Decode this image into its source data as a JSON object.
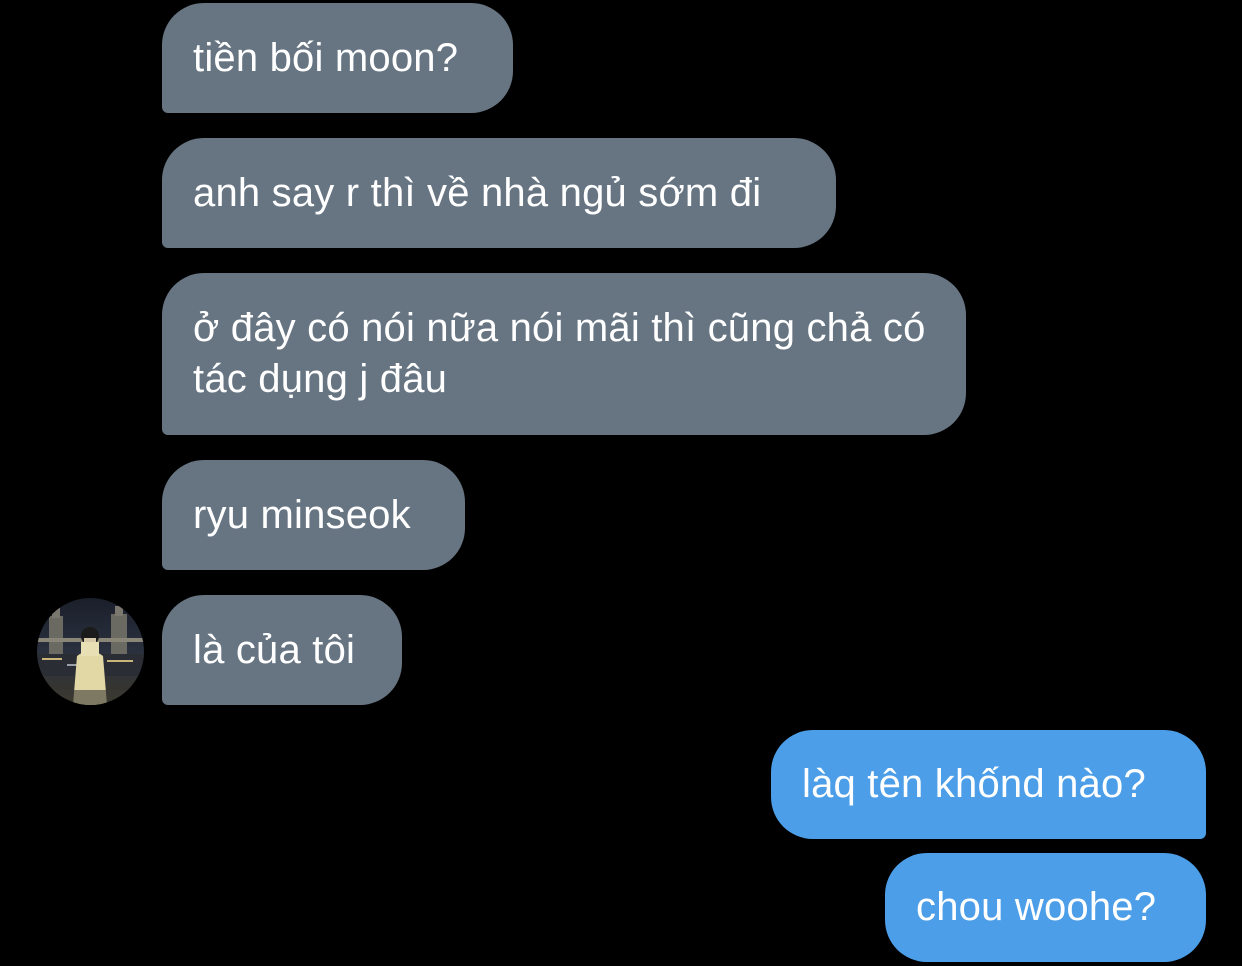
{
  "colors": {
    "background": "#000000",
    "incoming_bubble": "#677583",
    "outgoing_bubble": "#4c9ee8",
    "text": "#ffffff"
  },
  "messages": {
    "m1": "tiền bối moon?",
    "m2": "anh say r thì về nhà ngủ sớm đi",
    "m3": "ở đây có nói nữa nói mãi thì cũng chả có tác dụng j đâu",
    "m4": "ryu minseok",
    "m5": "là của tôi",
    "m6": "làq tên khốnd nào?",
    "m7": "chou woohe?"
  },
  "avatar": {
    "icon": "contact-avatar-photo"
  }
}
